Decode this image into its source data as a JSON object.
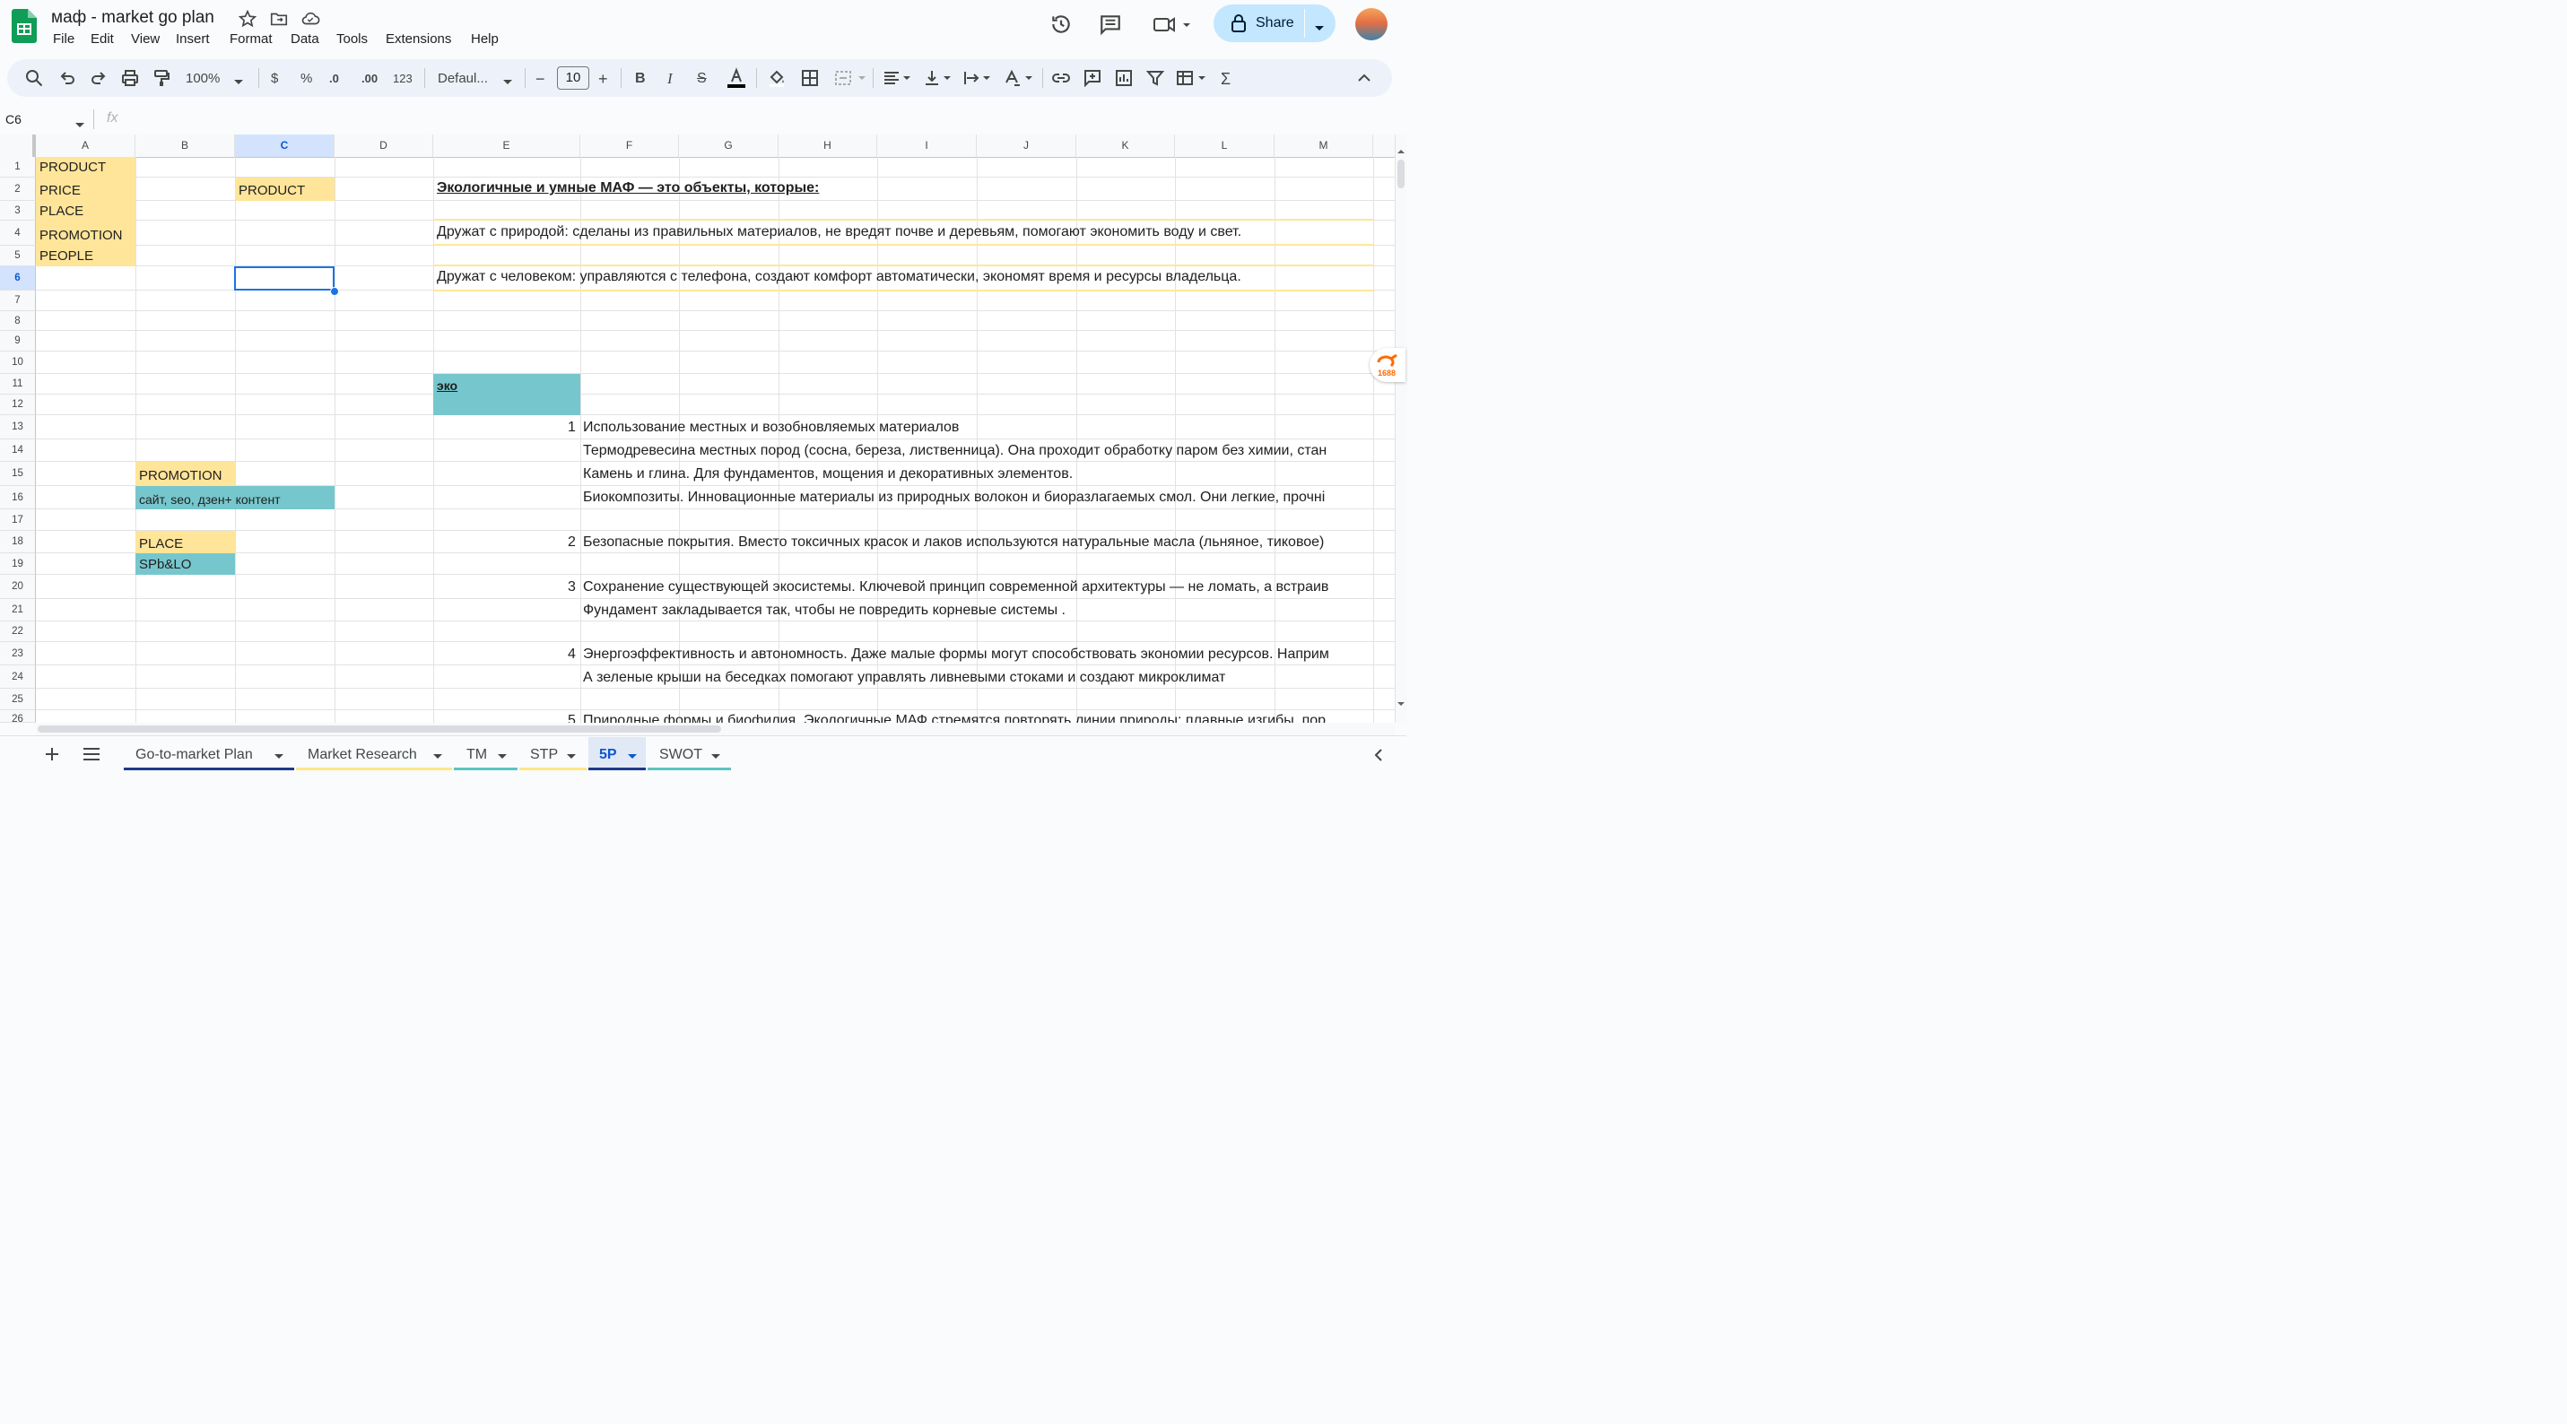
{
  "window": {
    "title": "маф - market go plan"
  },
  "menu": [
    "File",
    "Edit",
    "View",
    "Insert",
    "Format",
    "Data",
    "Tools",
    "Extensions",
    "Help"
  ],
  "share": {
    "label": "Share"
  },
  "toolbar": {
    "zoom": "100%",
    "currency": "$",
    "percent": "%",
    "dec_decrease": ".0",
    "dec_increase": ".00",
    "number_format": "123",
    "font": "Defaul...",
    "font_size": "10",
    "minus": "−",
    "plus": "+"
  },
  "formula_bar": {
    "cell_ref": "C6",
    "fx": "fx",
    "value": ""
  },
  "columns": [
    "A",
    "B",
    "C",
    "D",
    "E",
    "F",
    "G",
    "H",
    "I",
    "J",
    "K",
    "L",
    "M"
  ],
  "selected_column": "C",
  "rows": [
    "1",
    "2",
    "3",
    "4",
    "5",
    "6",
    "7",
    "8",
    "9",
    "10",
    "11",
    "12",
    "13",
    "14",
    "15",
    "16",
    "17",
    "18",
    "19",
    "20",
    "21",
    "22",
    "23",
    "24",
    "25",
    "26"
  ],
  "selected_row": "6",
  "cells": {
    "a1": "PRODUCT",
    "a2": "PRICE",
    "a3": "PLACE",
    "a4": "PROMOTION",
    "a5": "PEOPLE",
    "c2": "PRODUCT",
    "b15": "PROMOTION",
    "b16": "сайт, seo, дзен+ контент",
    "b18": "PLACE",
    "b19": "SPb&LO",
    "e2": "Экологичные и умные МАФ — это объекты, которые:",
    "e4": "Дружат с природой: сделаны из правильных материалов, не вредят почве и деревьям, помогают экономить воду и свет.",
    "e6": "Дружат с человеком: управляются с телефона, создают комфорт автоматически, экономят время и ресурсы владельца.",
    "e11": "эко",
    "n13": "1",
    "t13": "Использование местных и возобновляемых материалов",
    "t14": "Термодревесина местных пород (сосна, береза, лиственница). Она проходит обработку паром без химии, стан",
    "t15": "Камень и глина. Для фундаментов, мощения и декоративных элементов.",
    "t16": "Биокомпозиты. Инновационные материалы из природных волокон и биоразлагаемых смол. Они легкие, прочні",
    "n18": "2",
    "t18": "Безопасные покрытия. Вместо токсичных красок и лаков используются натуральные масла (льняное, тиковое)",
    "n20": "3",
    "t20": "Сохранение существующей экосистемы. Ключевой принцип современной архитектуры — не ломать, а встраив",
    "t21": "Фундамент закладывается так, чтобы не повредить корневые системы .",
    "n23": "4",
    "t23": "Энергоэффективность и автономность. Даже малые формы могут способствовать экономии ресурсов. Наприм",
    "t24": "А зеленые крыши на беседках помогают управлять ливневыми стоками и создают микроклимат",
    "n26": "5",
    "t26": "Природные формы и биофилия. Экологичные МАФ стремятся повторять линии природы: плавные изгибы, пор"
  },
  "sheet_tabs": [
    {
      "label": "Go-to-market Plan",
      "color": "#1e3a8a"
    },
    {
      "label": "Market Research",
      "color": "#fde68a"
    },
    {
      "label": "TM",
      "color": "#5ec4c0"
    },
    {
      "label": "STP",
      "color": "#fde68a"
    },
    {
      "label": "5P",
      "color": "#1e3a8a",
      "active": true
    },
    {
      "label": "SWOT",
      "color": "#5ec4c0"
    }
  ],
  "colors": {
    "yellow": "#ffe599",
    "teal": "#76c7cd",
    "accent": "#0b57d0",
    "share_bg": "#c2e7ff"
  },
  "ali_badge": {
    "text": "1688"
  }
}
